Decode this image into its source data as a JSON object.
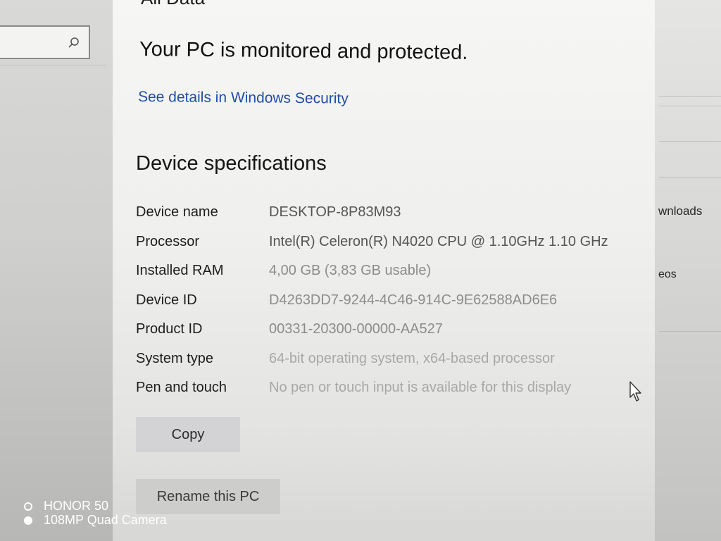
{
  "header_fragment": "All Data",
  "security": {
    "status": "Your PC is monitored and protected.",
    "link": "See details in Windows Security"
  },
  "specs": {
    "title": "Device specifications",
    "rows": [
      {
        "label": "Device name",
        "value": "DESKTOP-8P83M93"
      },
      {
        "label": "Processor",
        "value": "Intel(R) Celeron(R) N4020 CPU @ 1.10GHz   1.10 GHz"
      },
      {
        "label": "Installed RAM",
        "value": "4,00 GB (3,83 GB usable)"
      },
      {
        "label": "Device ID",
        "value": "D4263DD7-9244-4C46-914C-9E62588AD6E6"
      },
      {
        "label": "Product ID",
        "value": "00331-20300-00000-AA527"
      },
      {
        "label": "System type",
        "value": "64-bit operating system, x64-based processor"
      },
      {
        "label": "Pen and touch",
        "value": "No pen or touch input is available for this display"
      }
    ]
  },
  "buttons": {
    "copy": "Copy",
    "rename": "Rename this PC"
  },
  "background_window": {
    "downloads_fragment": "wnloads",
    "videos_fragment": "eos"
  },
  "watermark": {
    "line1": "HONOR 50",
    "line2": "108MP Quad Camera"
  },
  "colors": {
    "link": "#1f4ea8",
    "button": "#d3d3d5"
  },
  "icons": {
    "search": "search-icon",
    "cursor": "mouse-pointer-icon"
  }
}
